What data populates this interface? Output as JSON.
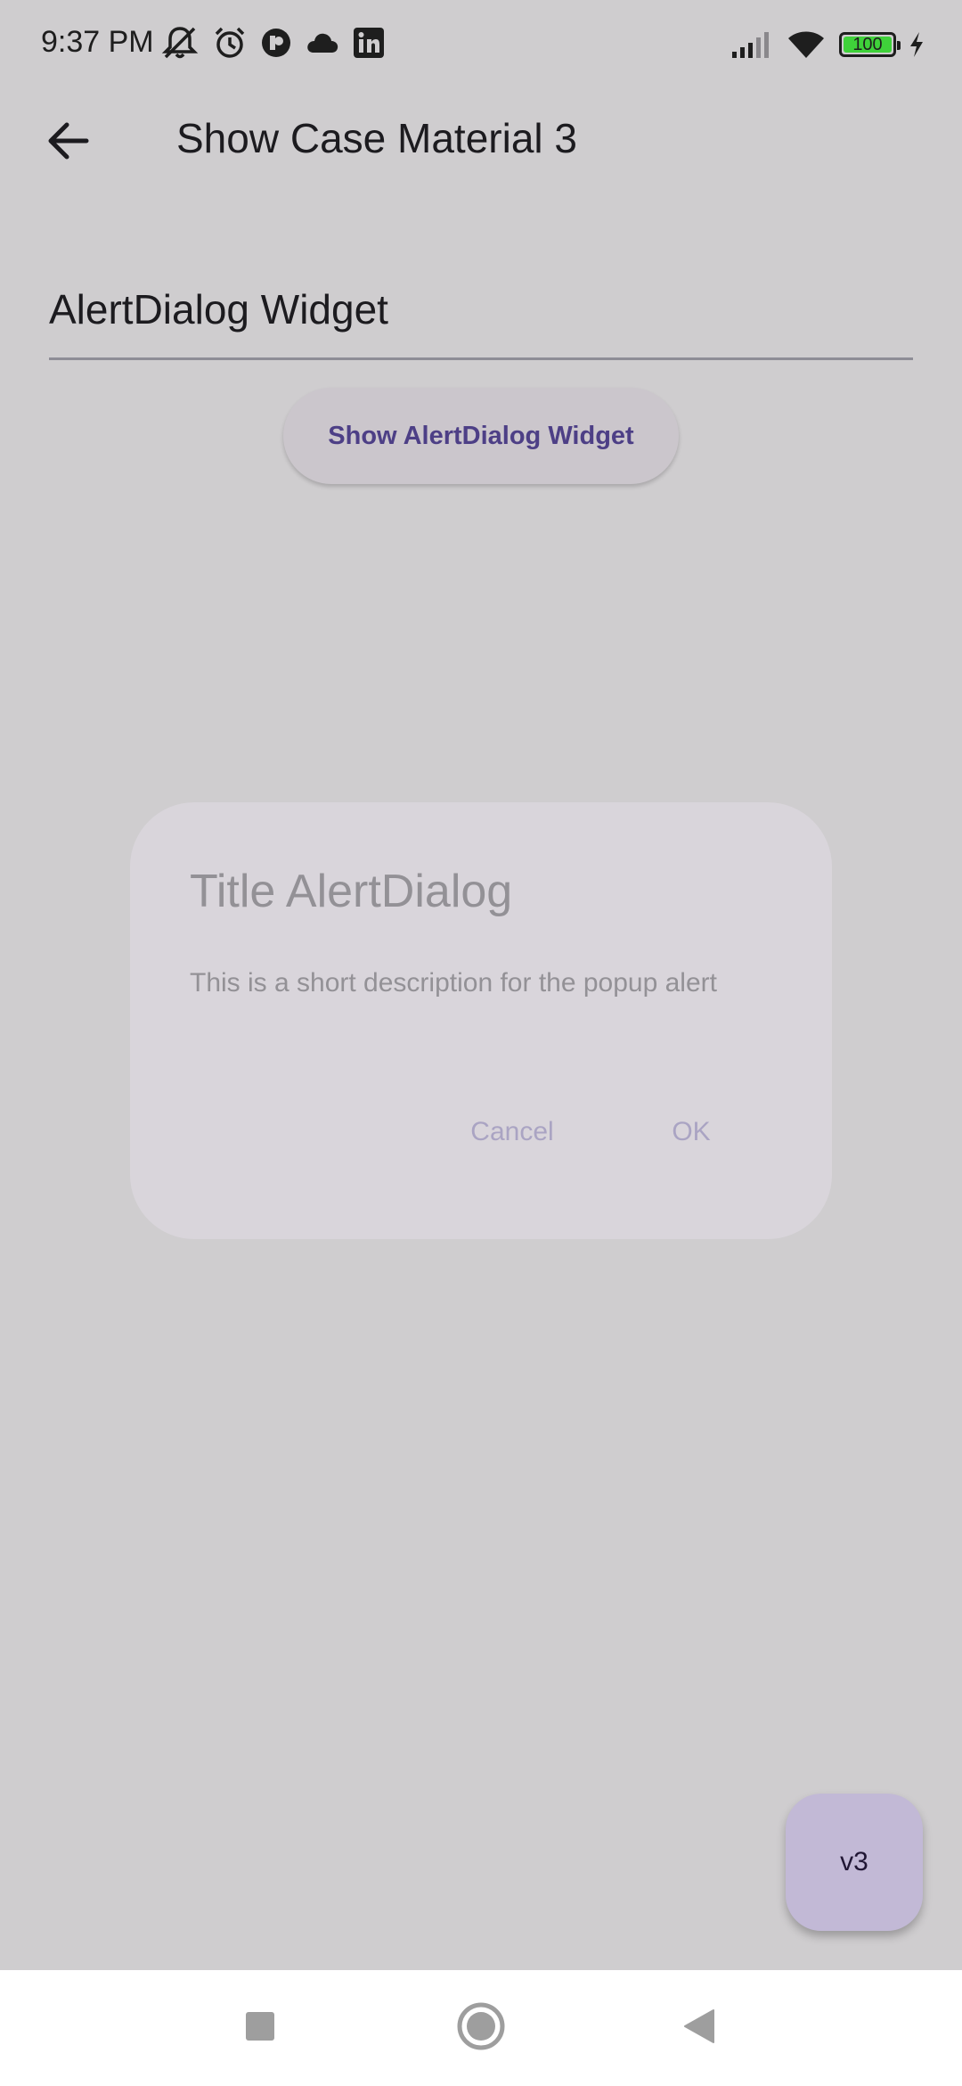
{
  "status_bar": {
    "time": "9:37 PM",
    "battery_level": "100",
    "icons_left": [
      "mute-icon",
      "alarm-icon",
      "app-notification-icon",
      "cloud-icon",
      "linkedin-icon"
    ],
    "icons_right": [
      "signal-icon",
      "wifi-icon",
      "battery-icon",
      "charging-icon"
    ],
    "battery_color": "#3fd23a"
  },
  "app_bar": {
    "title": "Show Case Material 3",
    "back_icon": "arrow-back-icon"
  },
  "text_field": {
    "value": "AlertDialog Widget"
  },
  "main": {
    "show_button_label": "Show AlertDialog Widget"
  },
  "dialog": {
    "title": "Title AlertDialog",
    "description": "This is a short description for the popup alert",
    "cancel_label": "Cancel",
    "ok_label": "OK"
  },
  "fab": {
    "label": "v3"
  },
  "nav_bar": {
    "icons": [
      "recents-icon",
      "home-icon",
      "back-icon"
    ]
  },
  "colors": {
    "accent": "#4d3f86",
    "scrim_background": "#cfcdcf",
    "dialog_surface": "#d9d5db",
    "fab_container": "#c2b9d6"
  }
}
